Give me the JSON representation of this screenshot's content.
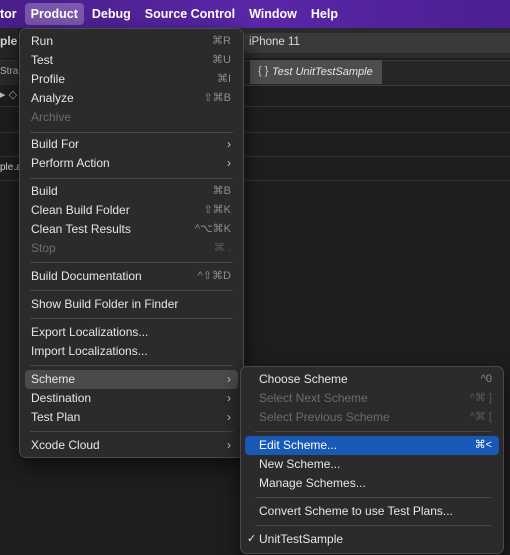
{
  "menubar": {
    "items": [
      "tor",
      "Product",
      "Debug",
      "Source Control",
      "Window",
      "Help"
    ]
  },
  "background": {
    "left_title": "ple",
    "left_row1": "Stra",
    "left_row2": "▸ ◇",
    "left_row3": "ple.a",
    "device": "iPhone 11",
    "tab_icon": "{ }",
    "tab_label": "Test UnitTestSample"
  },
  "product_menu": {
    "run": {
      "label": "Run",
      "shortcut": "⌘R"
    },
    "test": {
      "label": "Test",
      "shortcut": "⌘U"
    },
    "profile": {
      "label": "Profile",
      "shortcut": "⌘I"
    },
    "analyze": {
      "label": "Analyze",
      "shortcut": "⇧⌘B"
    },
    "archive": {
      "label": "Archive"
    },
    "build_for": {
      "label": "Build For"
    },
    "perform_action": {
      "label": "Perform Action"
    },
    "build": {
      "label": "Build",
      "shortcut": "⌘B"
    },
    "clean_build_folder": {
      "label": "Clean Build Folder",
      "shortcut": "⇧⌘K"
    },
    "clean_test_results": {
      "label": "Clean Test Results",
      "shortcut": "^⌥⌘K"
    },
    "stop": {
      "label": "Stop",
      "shortcut": "⌘ ."
    },
    "build_documentation": {
      "label": "Build Documentation",
      "shortcut": "^⇧⌘D"
    },
    "show_build_folder": {
      "label": "Show Build Folder in Finder"
    },
    "export_localizations": {
      "label": "Export Localizations..."
    },
    "import_localizations": {
      "label": "Import Localizations..."
    },
    "scheme": {
      "label": "Scheme"
    },
    "destination": {
      "label": "Destination"
    },
    "test_plan": {
      "label": "Test Plan"
    },
    "xcode_cloud": {
      "label": "Xcode Cloud"
    },
    "chevron": "›"
  },
  "scheme_menu": {
    "choose_scheme": {
      "label": "Choose Scheme",
      "shortcut": "^0"
    },
    "select_next_scheme": {
      "label": "Select Next Scheme",
      "shortcut": "^⌘ ]"
    },
    "select_previous_scheme": {
      "label": "Select Previous Scheme",
      "shortcut": "^⌘ ["
    },
    "edit_scheme": {
      "label": "Edit Scheme...",
      "shortcut": "⌘<"
    },
    "new_scheme": {
      "label": "New Scheme..."
    },
    "manage_schemes": {
      "label": "Manage Schemes..."
    },
    "convert_scheme": {
      "label": "Convert Scheme to use Test Plans..."
    },
    "current_scheme": {
      "label": "UnitTestSample",
      "check": "✓"
    }
  },
  "colors": {
    "menubar": "#5a27a8",
    "selection": "#1859b6",
    "menu_bg": "#2b2b2d"
  }
}
